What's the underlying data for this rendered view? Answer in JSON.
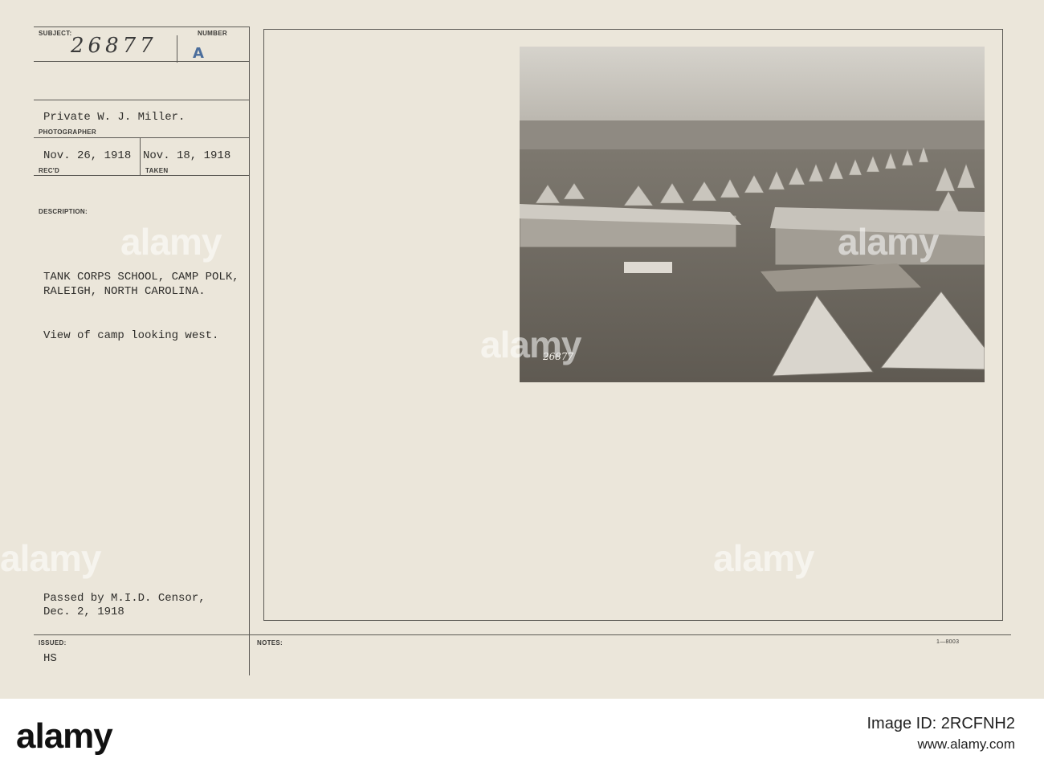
{
  "card": {
    "labels": {
      "subject": "SUBJECT:",
      "number": "NUMBER",
      "photographer": "PHOTOGRAPHER",
      "recd": "REC'D",
      "taken": "TAKEN",
      "description": "DESCRIPTION:",
      "issued": "ISSUED:",
      "notes": "NOTES:"
    },
    "subject_number": "26877",
    "number_stamp": "A",
    "photographer_name": "Private W. J. Miller.",
    "recd_date": "Nov. 26, 1918",
    "taken_date": "Nov. 18, 1918",
    "description": {
      "line1": "TANK CORPS SCHOOL, CAMP POLK,",
      "line2": "RALEIGH, NORTH CAROLINA.",
      "line3": "View of camp looking west."
    },
    "censor": {
      "line1": "Passed by M.I.D. Censor,",
      "line2": "Dec. 2, 1918"
    },
    "issued_value": "HS",
    "form_number": "1—8003",
    "photo_number": "26877"
  },
  "watermark": {
    "text": "alamy"
  },
  "footer": {
    "logo": "alamy",
    "image_id": "Image ID: 2RCFNH2",
    "site": "www.alamy.com"
  },
  "colors": {
    "card": "#ebe6da",
    "stamp": "#4b6e9c",
    "ink": "#2f2e2b"
  }
}
